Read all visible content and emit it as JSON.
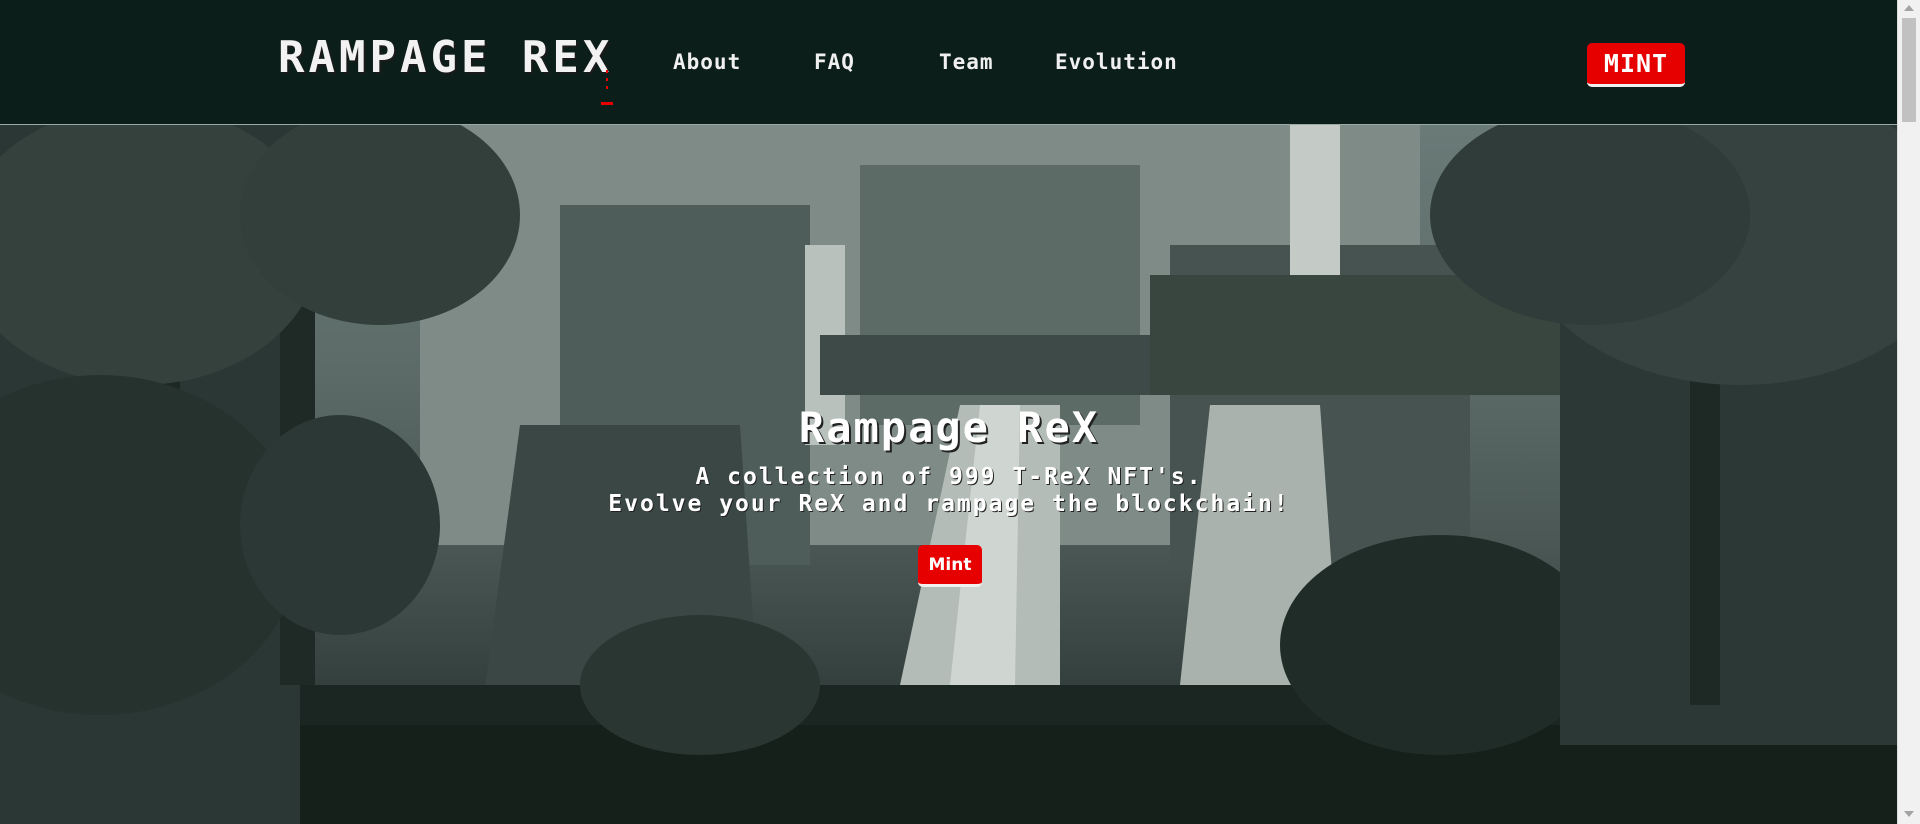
{
  "header": {
    "logo_text": "RAMPAGE REX",
    "nav": [
      {
        "label": "About"
      },
      {
        "label": "FAQ"
      },
      {
        "label": "Team"
      },
      {
        "label": "Evolution"
      }
    ],
    "mint_label": "MINT"
  },
  "hero": {
    "title": "Rampage ReX",
    "subtitle_line1": "A collection of 999 T-ReX NFT's.",
    "subtitle_line2": "Evolve your ReX and rampage the blockchain!",
    "mint_label": "Mint"
  },
  "colors": {
    "navbar_bg": "#0b1e19",
    "accent_red": "#e60000",
    "text": "#ffffff"
  },
  "icons": {
    "scroll_up": "chevron-up-icon",
    "scroll_down": "chevron-down-icon"
  }
}
